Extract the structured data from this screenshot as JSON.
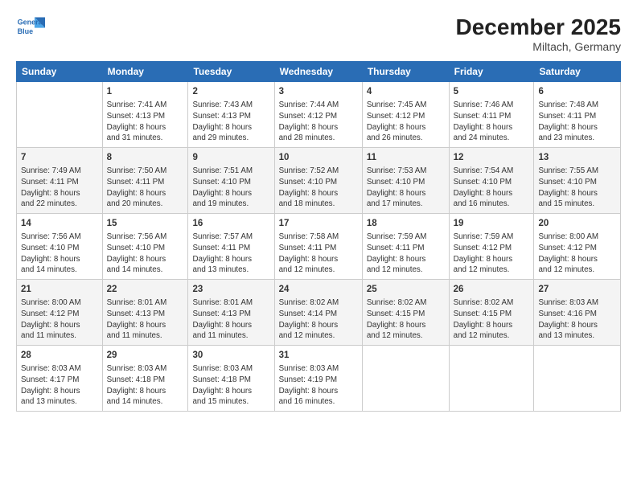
{
  "header": {
    "logo_line1": "General",
    "logo_line2": "Blue",
    "month": "December 2025",
    "location": "Miltach, Germany"
  },
  "weekdays": [
    "Sunday",
    "Monday",
    "Tuesday",
    "Wednesday",
    "Thursday",
    "Friday",
    "Saturday"
  ],
  "weeks": [
    [
      {
        "num": "",
        "detail": ""
      },
      {
        "num": "1",
        "detail": "Sunrise: 7:41 AM\nSunset: 4:13 PM\nDaylight: 8 hours\nand 31 minutes."
      },
      {
        "num": "2",
        "detail": "Sunrise: 7:43 AM\nSunset: 4:13 PM\nDaylight: 8 hours\nand 29 minutes."
      },
      {
        "num": "3",
        "detail": "Sunrise: 7:44 AM\nSunset: 4:12 PM\nDaylight: 8 hours\nand 28 minutes."
      },
      {
        "num": "4",
        "detail": "Sunrise: 7:45 AM\nSunset: 4:12 PM\nDaylight: 8 hours\nand 26 minutes."
      },
      {
        "num": "5",
        "detail": "Sunrise: 7:46 AM\nSunset: 4:11 PM\nDaylight: 8 hours\nand 24 minutes."
      },
      {
        "num": "6",
        "detail": "Sunrise: 7:48 AM\nSunset: 4:11 PM\nDaylight: 8 hours\nand 23 minutes."
      }
    ],
    [
      {
        "num": "7",
        "detail": "Sunrise: 7:49 AM\nSunset: 4:11 PM\nDaylight: 8 hours\nand 22 minutes."
      },
      {
        "num": "8",
        "detail": "Sunrise: 7:50 AM\nSunset: 4:11 PM\nDaylight: 8 hours\nand 20 minutes."
      },
      {
        "num": "9",
        "detail": "Sunrise: 7:51 AM\nSunset: 4:10 PM\nDaylight: 8 hours\nand 19 minutes."
      },
      {
        "num": "10",
        "detail": "Sunrise: 7:52 AM\nSunset: 4:10 PM\nDaylight: 8 hours\nand 18 minutes."
      },
      {
        "num": "11",
        "detail": "Sunrise: 7:53 AM\nSunset: 4:10 PM\nDaylight: 8 hours\nand 17 minutes."
      },
      {
        "num": "12",
        "detail": "Sunrise: 7:54 AM\nSunset: 4:10 PM\nDaylight: 8 hours\nand 16 minutes."
      },
      {
        "num": "13",
        "detail": "Sunrise: 7:55 AM\nSunset: 4:10 PM\nDaylight: 8 hours\nand 15 minutes."
      }
    ],
    [
      {
        "num": "14",
        "detail": "Sunrise: 7:56 AM\nSunset: 4:10 PM\nDaylight: 8 hours\nand 14 minutes."
      },
      {
        "num": "15",
        "detail": "Sunrise: 7:56 AM\nSunset: 4:10 PM\nDaylight: 8 hours\nand 14 minutes."
      },
      {
        "num": "16",
        "detail": "Sunrise: 7:57 AM\nSunset: 4:11 PM\nDaylight: 8 hours\nand 13 minutes."
      },
      {
        "num": "17",
        "detail": "Sunrise: 7:58 AM\nSunset: 4:11 PM\nDaylight: 8 hours\nand 12 minutes."
      },
      {
        "num": "18",
        "detail": "Sunrise: 7:59 AM\nSunset: 4:11 PM\nDaylight: 8 hours\nand 12 minutes."
      },
      {
        "num": "19",
        "detail": "Sunrise: 7:59 AM\nSunset: 4:12 PM\nDaylight: 8 hours\nand 12 minutes."
      },
      {
        "num": "20",
        "detail": "Sunrise: 8:00 AM\nSunset: 4:12 PM\nDaylight: 8 hours\nand 12 minutes."
      }
    ],
    [
      {
        "num": "21",
        "detail": "Sunrise: 8:00 AM\nSunset: 4:12 PM\nDaylight: 8 hours\nand 11 minutes."
      },
      {
        "num": "22",
        "detail": "Sunrise: 8:01 AM\nSunset: 4:13 PM\nDaylight: 8 hours\nand 11 minutes."
      },
      {
        "num": "23",
        "detail": "Sunrise: 8:01 AM\nSunset: 4:13 PM\nDaylight: 8 hours\nand 11 minutes."
      },
      {
        "num": "24",
        "detail": "Sunrise: 8:02 AM\nSunset: 4:14 PM\nDaylight: 8 hours\nand 12 minutes."
      },
      {
        "num": "25",
        "detail": "Sunrise: 8:02 AM\nSunset: 4:15 PM\nDaylight: 8 hours\nand 12 minutes."
      },
      {
        "num": "26",
        "detail": "Sunrise: 8:02 AM\nSunset: 4:15 PM\nDaylight: 8 hours\nand 12 minutes."
      },
      {
        "num": "27",
        "detail": "Sunrise: 8:03 AM\nSunset: 4:16 PM\nDaylight: 8 hours\nand 13 minutes."
      }
    ],
    [
      {
        "num": "28",
        "detail": "Sunrise: 8:03 AM\nSunset: 4:17 PM\nDaylight: 8 hours\nand 13 minutes."
      },
      {
        "num": "29",
        "detail": "Sunrise: 8:03 AM\nSunset: 4:18 PM\nDaylight: 8 hours\nand 14 minutes."
      },
      {
        "num": "30",
        "detail": "Sunrise: 8:03 AM\nSunset: 4:18 PM\nDaylight: 8 hours\nand 15 minutes."
      },
      {
        "num": "31",
        "detail": "Sunrise: 8:03 AM\nSunset: 4:19 PM\nDaylight: 8 hours\nand 16 minutes."
      },
      {
        "num": "",
        "detail": ""
      },
      {
        "num": "",
        "detail": ""
      },
      {
        "num": "",
        "detail": ""
      }
    ]
  ]
}
